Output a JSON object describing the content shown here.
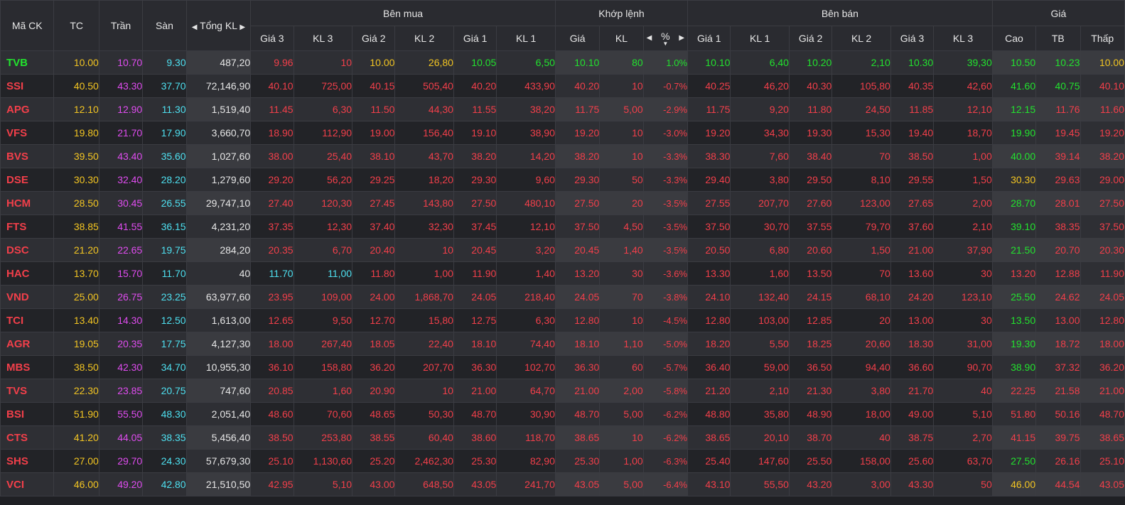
{
  "colors": {
    "ref": "#f3c522",
    "ceil": "#e04cf0",
    "floor": "#4ee0f0",
    "up": "#22e22e",
    "down": "#f23f4a",
    "white": "#e6e6e6"
  },
  "header": {
    "ma_ck": "Mã CK",
    "tc": "TC",
    "tran": "Trần",
    "san": "Sàn",
    "tong_kl": "Tổng KL",
    "groups": {
      "ben_mua": "Bên mua",
      "khop_lenh": "Khớp lệnh",
      "ben_ban": "Bên bán",
      "gia": "Giá"
    },
    "buy_cols": [
      "Giá 3",
      "KL 3",
      "Giá 2",
      "KL 2",
      "Giá 1",
      "KL 1"
    ],
    "match_cols": [
      "Giá",
      "KL",
      "%"
    ],
    "sell_cols": [
      "Giá 1",
      "KL 1",
      "Giá 2",
      "KL 2",
      "Giá 3",
      "KL 3"
    ],
    "price_cols": [
      "Cao",
      "TB",
      "Thấp"
    ]
  },
  "rows": [
    {
      "sym": "TVB",
      "tc": "10.00",
      "tran": "10.70",
      "san": "9.30",
      "tkl": "487,20",
      "b3p": "9.96",
      "b3v": "10",
      "b2p": "10.00",
      "b2v": "26,80",
      "b1p": "10.05",
      "b1v": "6,50",
      "mp": "10.10",
      "mv": "80",
      "pct": "1.0%",
      "s1p": "10.10",
      "s1v": "6,40",
      "s2p": "10.20",
      "s2v": "2,10",
      "s3p": "10.30",
      "s3v": "39,30",
      "hi": "10.50",
      "avg": "10.23",
      "lo": "10.00",
      "cl": {
        "sym": "up",
        "b3p": "down",
        "b3v": "down",
        "b2p": "ref",
        "b2v": "ref",
        "b1p": "up",
        "b1v": "up",
        "m": "up",
        "s1": "up",
        "s2": "up",
        "s3": "up",
        "hi": "up",
        "avg": "up",
        "lo": "ref"
      }
    },
    {
      "sym": "SSI",
      "tc": "40.50",
      "tran": "43.30",
      "san": "37.70",
      "tkl": "72,146,90",
      "b3p": "40.10",
      "b3v": "725,00",
      "b2p": "40.15",
      "b2v": "505,40",
      "b1p": "40.20",
      "b1v": "433,90",
      "mp": "40.20",
      "mv": "10",
      "pct": "-0.7%",
      "s1p": "40.25",
      "s1v": "46,20",
      "s2p": "40.30",
      "s2v": "105,80",
      "s3p": "40.35",
      "s3v": "42,60",
      "hi": "41.60",
      "avg": "40.75",
      "lo": "40.10",
      "cl": {
        "sym": "down",
        "b3p": "down",
        "b3v": "down",
        "b2p": "down",
        "b2v": "down",
        "b1p": "down",
        "b1v": "down",
        "m": "down",
        "s1": "down",
        "s2": "down",
        "s3": "down",
        "hi": "up",
        "avg": "up",
        "lo": "down"
      }
    },
    {
      "sym": "APG",
      "tc": "12.10",
      "tran": "12.90",
      "san": "11.30",
      "tkl": "1,519,40",
      "b3p": "11.45",
      "b3v": "6,30",
      "b2p": "11.50",
      "b2v": "44,30",
      "b1p": "11.55",
      "b1v": "38,20",
      "mp": "11.75",
      "mv": "5,00",
      "pct": "-2.9%",
      "s1p": "11.75",
      "s1v": "9,20",
      "s2p": "11.80",
      "s2v": "24,50",
      "s3p": "11.85",
      "s3v": "12,10",
      "hi": "12.15",
      "avg": "11.76",
      "lo": "11.60",
      "cl": {
        "sym": "down",
        "b3p": "down",
        "b3v": "down",
        "b2p": "down",
        "b2v": "down",
        "b1p": "down",
        "b1v": "down",
        "m": "down",
        "s1": "down",
        "s2": "down",
        "s3": "down",
        "hi": "up",
        "avg": "down",
        "lo": "down"
      }
    },
    {
      "sym": "VFS",
      "tc": "19.80",
      "tran": "21.70",
      "san": "17.90",
      "tkl": "3,660,70",
      "b3p": "18.90",
      "b3v": "112,90",
      "b2p": "19.00",
      "b2v": "156,40",
      "b1p": "19.10",
      "b1v": "38,90",
      "mp": "19.20",
      "mv": "10",
      "pct": "-3.0%",
      "s1p": "19.20",
      "s1v": "34,30",
      "s2p": "19.30",
      "s2v": "15,30",
      "s3p": "19.40",
      "s3v": "18,70",
      "hi": "19.90",
      "avg": "19.45",
      "lo": "19.20",
      "cl": {
        "sym": "down",
        "b3p": "down",
        "b3v": "down",
        "b2p": "down",
        "b2v": "down",
        "b1p": "down",
        "b1v": "down",
        "m": "down",
        "s1": "down",
        "s2": "down",
        "s3": "down",
        "hi": "up",
        "avg": "down",
        "lo": "down"
      }
    },
    {
      "sym": "BVS",
      "tc": "39.50",
      "tran": "43.40",
      "san": "35.60",
      "tkl": "1,027,60",
      "b3p": "38.00",
      "b3v": "25,40",
      "b2p": "38.10",
      "b2v": "43,70",
      "b1p": "38.20",
      "b1v": "14,20",
      "mp": "38.20",
      "mv": "10",
      "pct": "-3.3%",
      "s1p": "38.30",
      "s1v": "7,60",
      "s2p": "38.40",
      "s2v": "70",
      "s3p": "38.50",
      "s3v": "1,00",
      "hi": "40.00",
      "avg": "39.14",
      "lo": "38.20",
      "cl": {
        "sym": "down",
        "b3p": "down",
        "b3v": "down",
        "b2p": "down",
        "b2v": "down",
        "b1p": "down",
        "b1v": "down",
        "m": "down",
        "s1": "down",
        "s2": "down",
        "s3": "down",
        "hi": "up",
        "avg": "down",
        "lo": "down"
      }
    },
    {
      "sym": "DSE",
      "tc": "30.30",
      "tran": "32.40",
      "san": "28.20",
      "tkl": "1,279,60",
      "b3p": "29.20",
      "b3v": "56,20",
      "b2p": "29.25",
      "b2v": "18,20",
      "b1p": "29.30",
      "b1v": "9,60",
      "mp": "29.30",
      "mv": "50",
      "pct": "-3.3%",
      "s1p": "29.40",
      "s1v": "3,80",
      "s2p": "29.50",
      "s2v": "8,10",
      "s3p": "29.55",
      "s3v": "1,50",
      "hi": "30.30",
      "avg": "29.63",
      "lo": "29.00",
      "cl": {
        "sym": "down",
        "b3p": "down",
        "b3v": "down",
        "b2p": "down",
        "b2v": "down",
        "b1p": "down",
        "b1v": "down",
        "m": "down",
        "s1": "down",
        "s2": "down",
        "s3": "down",
        "hi": "ref",
        "avg": "down",
        "lo": "down"
      }
    },
    {
      "sym": "HCM",
      "tc": "28.50",
      "tran": "30.45",
      "san": "26.55",
      "tkl": "29,747,10",
      "b3p": "27.40",
      "b3v": "120,30",
      "b2p": "27.45",
      "b2v": "143,80",
      "b1p": "27.50",
      "b1v": "480,10",
      "mp": "27.50",
      "mv": "20",
      "pct": "-3.5%",
      "s1p": "27.55",
      "s1v": "207,70",
      "s2p": "27.60",
      "s2v": "123,00",
      "s3p": "27.65",
      "s3v": "2,00",
      "hi": "28.70",
      "avg": "28.01",
      "lo": "27.50",
      "cl": {
        "sym": "down",
        "b3p": "down",
        "b3v": "down",
        "b2p": "down",
        "b2v": "down",
        "b1p": "down",
        "b1v": "down",
        "m": "down",
        "s1": "down",
        "s2": "down",
        "s3": "down",
        "hi": "up",
        "avg": "down",
        "lo": "down"
      }
    },
    {
      "sym": "FTS",
      "tc": "38.85",
      "tran": "41.55",
      "san": "36.15",
      "tkl": "4,231,20",
      "b3p": "37.35",
      "b3v": "12,30",
      "b2p": "37.40",
      "b2v": "32,30",
      "b1p": "37.45",
      "b1v": "12,10",
      "mp": "37.50",
      "mv": "4,50",
      "pct": "-3.5%",
      "s1p": "37.50",
      "s1v": "30,70",
      "s2p": "37.55",
      "s2v": "79,70",
      "s3p": "37.60",
      "s3v": "2,10",
      "hi": "39.10",
      "avg": "38.35",
      "lo": "37.50",
      "cl": {
        "sym": "down",
        "b3p": "down",
        "b3v": "down",
        "b2p": "down",
        "b2v": "down",
        "b1p": "down",
        "b1v": "down",
        "m": "down",
        "s1": "down",
        "s2": "down",
        "s3": "down",
        "hi": "up",
        "avg": "down",
        "lo": "down"
      }
    },
    {
      "sym": "DSC",
      "tc": "21.20",
      "tran": "22.65",
      "san": "19.75",
      "tkl": "284,20",
      "b3p": "20.35",
      "b3v": "6,70",
      "b2p": "20.40",
      "b2v": "10",
      "b1p": "20.45",
      "b1v": "3,20",
      "mp": "20.45",
      "mv": "1,40",
      "pct": "-3.5%",
      "s1p": "20.50",
      "s1v": "6,80",
      "s2p": "20.60",
      "s2v": "1,50",
      "s3p": "21.00",
      "s3v": "37,90",
      "hi": "21.50",
      "avg": "20.70",
      "lo": "20.30",
      "cl": {
        "sym": "down",
        "b3p": "down",
        "b3v": "down",
        "b2p": "down",
        "b2v": "down",
        "b1p": "down",
        "b1v": "down",
        "m": "down",
        "s1": "down",
        "s2": "down",
        "s3": "down",
        "hi": "up",
        "avg": "down",
        "lo": "down"
      }
    },
    {
      "sym": "HAC",
      "tc": "13.70",
      "tran": "15.70",
      "san": "11.70",
      "tkl": "40",
      "b3p": "11.70",
      "b3v": "11,00",
      "b2p": "11.80",
      "b2v": "1,00",
      "b1p": "11.90",
      "b1v": "1,40",
      "mp": "13.20",
      "mv": "30",
      "pct": "-3.6%",
      "s1p": "13.30",
      "s1v": "1,60",
      "s2p": "13.50",
      "s2v": "70",
      "s3p": "13.60",
      "s3v": "30",
      "hi": "13.20",
      "avg": "12.88",
      "lo": "11.90",
      "cl": {
        "sym": "down",
        "b3p": "floor",
        "b3v": "floor",
        "b2p": "down",
        "b2v": "down",
        "b1p": "down",
        "b1v": "down",
        "m": "down",
        "s1": "down",
        "s2": "down",
        "s3": "down",
        "hi": "down",
        "avg": "down",
        "lo": "down"
      }
    },
    {
      "sym": "VND",
      "tc": "25.00",
      "tran": "26.75",
      "san": "23.25",
      "tkl": "63,977,60",
      "b3p": "23.95",
      "b3v": "109,00",
      "b2p": "24.00",
      "b2v": "1,868,70",
      "b1p": "24.05",
      "b1v": "218,40",
      "mp": "24.05",
      "mv": "70",
      "pct": "-3.8%",
      "s1p": "24.10",
      "s1v": "132,40",
      "s2p": "24.15",
      "s2v": "68,10",
      "s3p": "24.20",
      "s3v": "123,10",
      "hi": "25.50",
      "avg": "24.62",
      "lo": "24.05",
      "cl": {
        "sym": "down",
        "b3p": "down",
        "b3v": "down",
        "b2p": "down",
        "b2v": "down",
        "b1p": "down",
        "b1v": "down",
        "m": "down",
        "s1": "down",
        "s2": "down",
        "s3": "down",
        "hi": "up",
        "avg": "down",
        "lo": "down"
      }
    },
    {
      "sym": "TCI",
      "tc": "13.40",
      "tran": "14.30",
      "san": "12.50",
      "tkl": "1,613,00",
      "b3p": "12.65",
      "b3v": "9,50",
      "b2p": "12.70",
      "b2v": "15,80",
      "b1p": "12.75",
      "b1v": "6,30",
      "mp": "12.80",
      "mv": "10",
      "pct": "-4.5%",
      "s1p": "12.80",
      "s1v": "103,00",
      "s2p": "12.85",
      "s2v": "20",
      "s3p": "13.00",
      "s3v": "30",
      "hi": "13.50",
      "avg": "13.00",
      "lo": "12.80",
      "cl": {
        "sym": "down",
        "b3p": "down",
        "b3v": "down",
        "b2p": "down",
        "b2v": "down",
        "b1p": "down",
        "b1v": "down",
        "m": "down",
        "s1": "down",
        "s2": "down",
        "s3": "down",
        "hi": "up",
        "avg": "down",
        "lo": "down"
      }
    },
    {
      "sym": "AGR",
      "tc": "19.05",
      "tran": "20.35",
      "san": "17.75",
      "tkl": "4,127,30",
      "b3p": "18.00",
      "b3v": "267,40",
      "b2p": "18.05",
      "b2v": "22,40",
      "b1p": "18.10",
      "b1v": "74,40",
      "mp": "18.10",
      "mv": "1,10",
      "pct": "-5.0%",
      "s1p": "18.20",
      "s1v": "5,50",
      "s2p": "18.25",
      "s2v": "20,60",
      "s3p": "18.30",
      "s3v": "31,00",
      "hi": "19.30",
      "avg": "18.72",
      "lo": "18.00",
      "cl": {
        "sym": "down",
        "b3p": "down",
        "b3v": "down",
        "b2p": "down",
        "b2v": "down",
        "b1p": "down",
        "b1v": "down",
        "m": "down",
        "s1": "down",
        "s2": "down",
        "s3": "down",
        "hi": "up",
        "avg": "down",
        "lo": "down"
      }
    },
    {
      "sym": "MBS",
      "tc": "38.50",
      "tran": "42.30",
      "san": "34.70",
      "tkl": "10,955,30",
      "b3p": "36.10",
      "b3v": "158,80",
      "b2p": "36.20",
      "b2v": "207,70",
      "b1p": "36.30",
      "b1v": "102,70",
      "mp": "36.30",
      "mv": "60",
      "pct": "-5.7%",
      "s1p": "36.40",
      "s1v": "59,00",
      "s2p": "36.50",
      "s2v": "94,40",
      "s3p": "36.60",
      "s3v": "90,70",
      "hi": "38.90",
      "avg": "37.32",
      "lo": "36.20",
      "cl": {
        "sym": "down",
        "b3p": "down",
        "b3v": "down",
        "b2p": "down",
        "b2v": "down",
        "b1p": "down",
        "b1v": "down",
        "m": "down",
        "s1": "down",
        "s2": "down",
        "s3": "down",
        "hi": "up",
        "avg": "down",
        "lo": "down"
      }
    },
    {
      "sym": "TVS",
      "tc": "22.30",
      "tran": "23.85",
      "san": "20.75",
      "tkl": "747,60",
      "b3p": "20.85",
      "b3v": "1,60",
      "b2p": "20.90",
      "b2v": "10",
      "b1p": "21.00",
      "b1v": "64,70",
      "mp": "21.00",
      "mv": "2,00",
      "pct": "-5.8%",
      "s1p": "21.20",
      "s1v": "2,10",
      "s2p": "21.30",
      "s2v": "3,80",
      "s3p": "21.70",
      "s3v": "40",
      "hi": "22.25",
      "avg": "21.58",
      "lo": "21.00",
      "cl": {
        "sym": "down",
        "b3p": "down",
        "b3v": "down",
        "b2p": "down",
        "b2v": "down",
        "b1p": "down",
        "b1v": "down",
        "m": "down",
        "s1": "down",
        "s2": "down",
        "s3": "down",
        "hi": "down",
        "avg": "down",
        "lo": "down"
      }
    },
    {
      "sym": "BSI",
      "tc": "51.90",
      "tran": "55.50",
      "san": "48.30",
      "tkl": "2,051,40",
      "b3p": "48.60",
      "b3v": "70,60",
      "b2p": "48.65",
      "b2v": "50,30",
      "b1p": "48.70",
      "b1v": "30,90",
      "mp": "48.70",
      "mv": "5,00",
      "pct": "-6.2%",
      "s1p": "48.80",
      "s1v": "35,80",
      "s2p": "48.90",
      "s2v": "18,00",
      "s3p": "49.00",
      "s3v": "5,10",
      "hi": "51.80",
      "avg": "50.16",
      "lo": "48.70",
      "cl": {
        "sym": "down",
        "b3p": "down",
        "b3v": "down",
        "b2p": "down",
        "b2v": "down",
        "b1p": "down",
        "b1v": "down",
        "m": "down",
        "s1": "down",
        "s2": "down",
        "s3": "down",
        "hi": "down",
        "avg": "down",
        "lo": "down"
      }
    },
    {
      "sym": "CTS",
      "tc": "41.20",
      "tran": "44.05",
      "san": "38.35",
      "tkl": "5,456,40",
      "b3p": "38.50",
      "b3v": "253,80",
      "b2p": "38.55",
      "b2v": "60,40",
      "b1p": "38.60",
      "b1v": "118,70",
      "mp": "38.65",
      "mv": "10",
      "pct": "-6.2%",
      "s1p": "38.65",
      "s1v": "20,10",
      "s2p": "38.70",
      "s2v": "40",
      "s3p": "38.75",
      "s3v": "2,70",
      "hi": "41.15",
      "avg": "39.75",
      "lo": "38.65",
      "cl": {
        "sym": "down",
        "b3p": "down",
        "b3v": "down",
        "b2p": "down",
        "b2v": "down",
        "b1p": "down",
        "b1v": "down",
        "m": "down",
        "s1": "down",
        "s2": "down",
        "s3": "down",
        "hi": "down",
        "avg": "down",
        "lo": "down"
      }
    },
    {
      "sym": "SHS",
      "tc": "27.00",
      "tran": "29.70",
      "san": "24.30",
      "tkl": "57,679,30",
      "b3p": "25.10",
      "b3v": "1,130,60",
      "b2p": "25.20",
      "b2v": "2,462,30",
      "b1p": "25.30",
      "b1v": "82,90",
      "mp": "25.30",
      "mv": "1,00",
      "pct": "-6.3%",
      "s1p": "25.40",
      "s1v": "147,60",
      "s2p": "25.50",
      "s2v": "158,00",
      "s3p": "25.60",
      "s3v": "63,70",
      "hi": "27.50",
      "avg": "26.16",
      "lo": "25.10",
      "cl": {
        "sym": "down",
        "b3p": "down",
        "b3v": "down",
        "b2p": "down",
        "b2v": "down",
        "b1p": "down",
        "b1v": "down",
        "m": "down",
        "s1": "down",
        "s2": "down",
        "s3": "down",
        "hi": "up",
        "avg": "down",
        "lo": "down"
      }
    },
    {
      "sym": "VCI",
      "tc": "46.00",
      "tran": "49.20",
      "san": "42.80",
      "tkl": "21,510,50",
      "b3p": "42.95",
      "b3v": "5,10",
      "b2p": "43.00",
      "b2v": "648,50",
      "b1p": "43.05",
      "b1v": "241,70",
      "mp": "43.05",
      "mv": "5,00",
      "pct": "-6.4%",
      "s1p": "43.10",
      "s1v": "55,50",
      "s2p": "43.20",
      "s2v": "3,00",
      "s3p": "43.30",
      "s3v": "50",
      "hi": "46.00",
      "avg": "44.54",
      "lo": "43.05",
      "cl": {
        "sym": "down",
        "b3p": "down",
        "b3v": "down",
        "b2p": "down",
        "b2v": "down",
        "b1p": "down",
        "b1v": "down",
        "m": "down",
        "s1": "down",
        "s2": "down",
        "s3": "down",
        "hi": "ref",
        "avg": "down",
        "lo": "down"
      }
    }
  ]
}
